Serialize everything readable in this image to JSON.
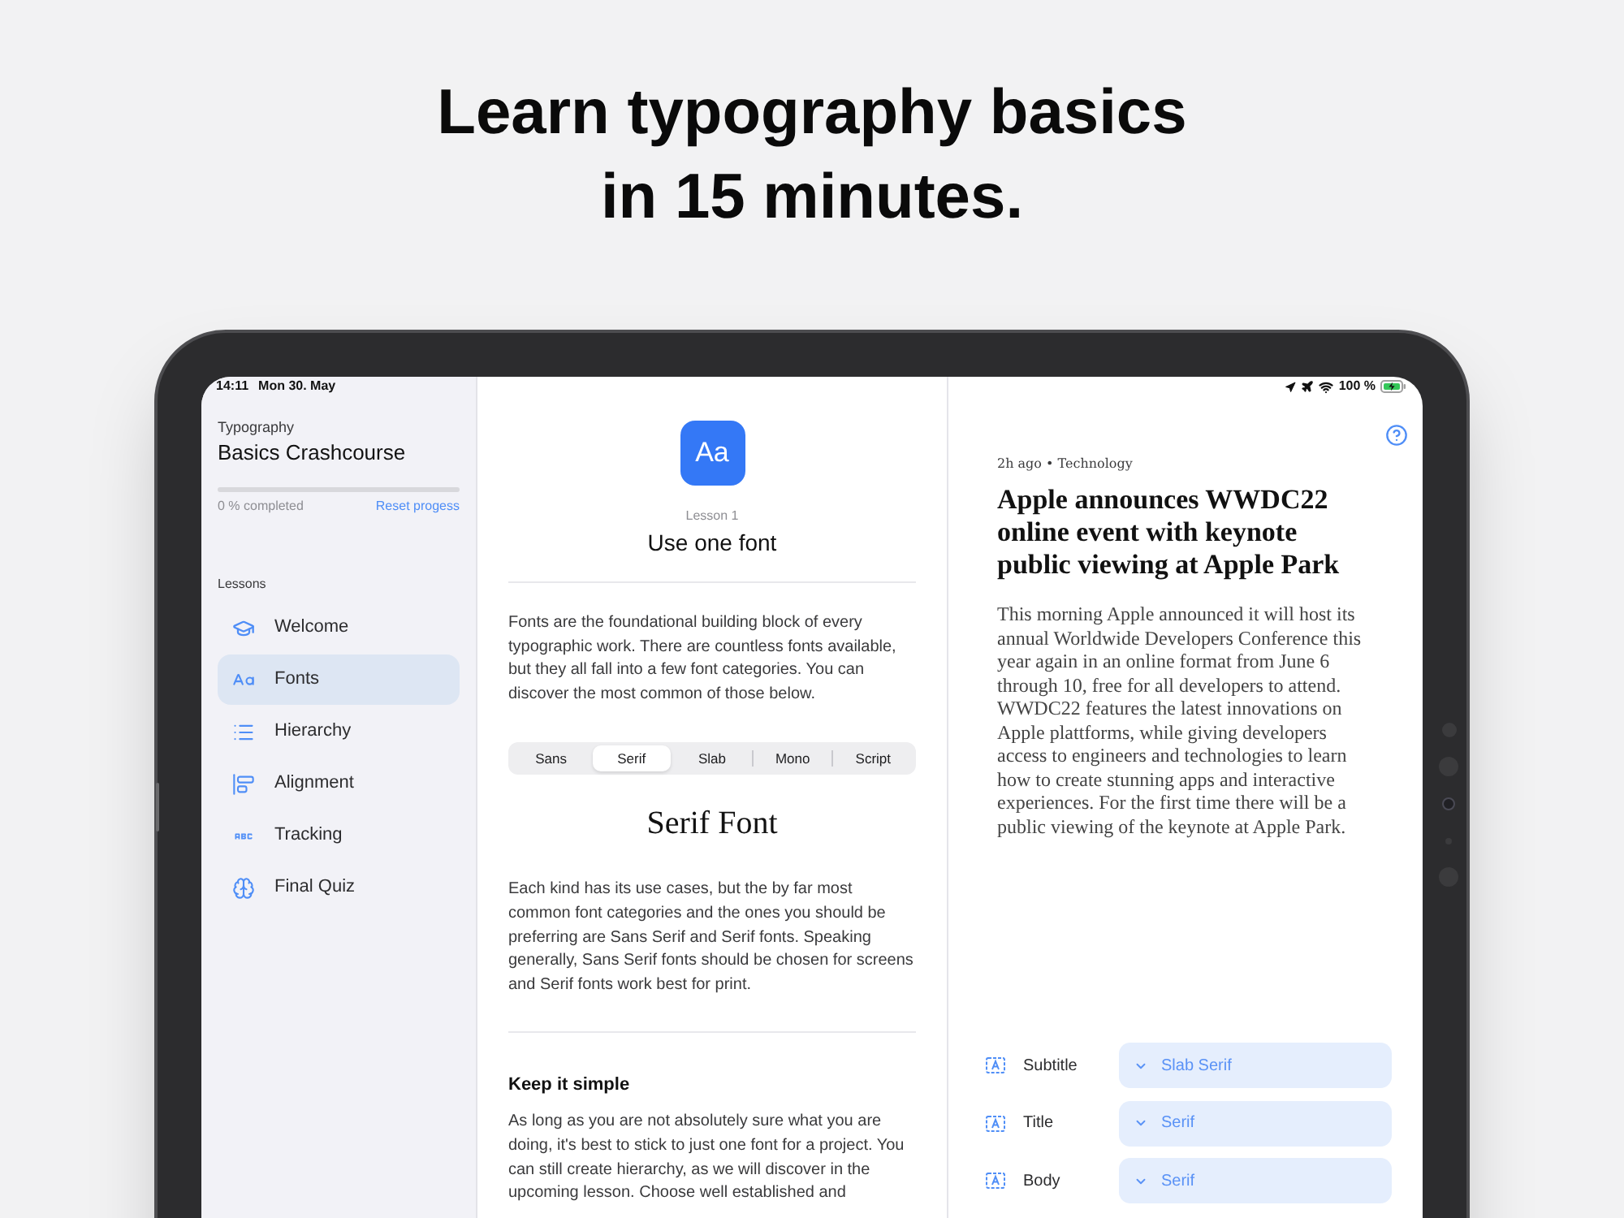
{
  "headline": "Learn typography basics in 15 minutes.",
  "status_bar": {
    "time": "14:11",
    "date": "Mon 30. May",
    "battery": "100 %"
  },
  "sidebar": {
    "course_category": "Typography",
    "course_title": "Basics Crashcourse",
    "progress": {
      "label": "0 % completed",
      "reset_link": "Reset progess"
    },
    "section_label": "Lessons",
    "items": [
      {
        "label": "Welcome",
        "selected": false
      },
      {
        "label": "Fonts",
        "selected": true
      },
      {
        "label": "Hierarchy",
        "selected": false
      },
      {
        "label": "Alignment",
        "selected": false
      },
      {
        "label": "Tracking",
        "selected": false
      },
      {
        "label": "Final Quiz",
        "selected": false
      }
    ]
  },
  "lesson": {
    "icon_text": "Aa",
    "number": "Lesson 1",
    "title": "Use one font",
    "intro": "Fonts are the foundational building block of every typographic work. There are countless fonts available, but they all fall into a few font categories. You can discover the most common of those below.",
    "categories": [
      {
        "label": "Sans",
        "selected": false
      },
      {
        "label": "Serif",
        "selected": true
      },
      {
        "label": "Slab",
        "selected": false
      },
      {
        "label": "Mono",
        "selected": false
      },
      {
        "label": "Script",
        "selected": false
      }
    ],
    "sample_title": "Serif Font",
    "body": "Each kind has its use cases, but the by far most common font categories and the ones you should be preferring are Sans Serif and Serif fonts. Speaking generally, Sans Serif fonts should be chosen for screens and Serif fonts work best for print.",
    "section_heading": "Keep it simple",
    "section_body": "As long as you are not absolutely sure what you are doing, it's best to stick to just one font for a project. You can still create hierarchy, as we will discover in the upcoming lesson. Choose well established and"
  },
  "article": {
    "meta": "2h ago • Technology",
    "title": "Apple announces WWDC22 online event with keynote public viewing at Apple Park",
    "body": "This morning Apple announced it will host its annual Worldwide Developers Conference this year again in an online format from June 6 through 10, free for all developers to attend. WWDC22 features the latest innovations on Apple plattforms, while giving developers access to engineers and technologies to learn how to create stunning apps and interactive experiences. For the first time there will be a public viewing of the keynote at Apple Park."
  },
  "style_settings": [
    {
      "label": "Subtitle",
      "value": "Slab Serif"
    },
    {
      "label": "Title",
      "value": "Serif"
    },
    {
      "label": "Body",
      "value": "Serif"
    }
  ]
}
